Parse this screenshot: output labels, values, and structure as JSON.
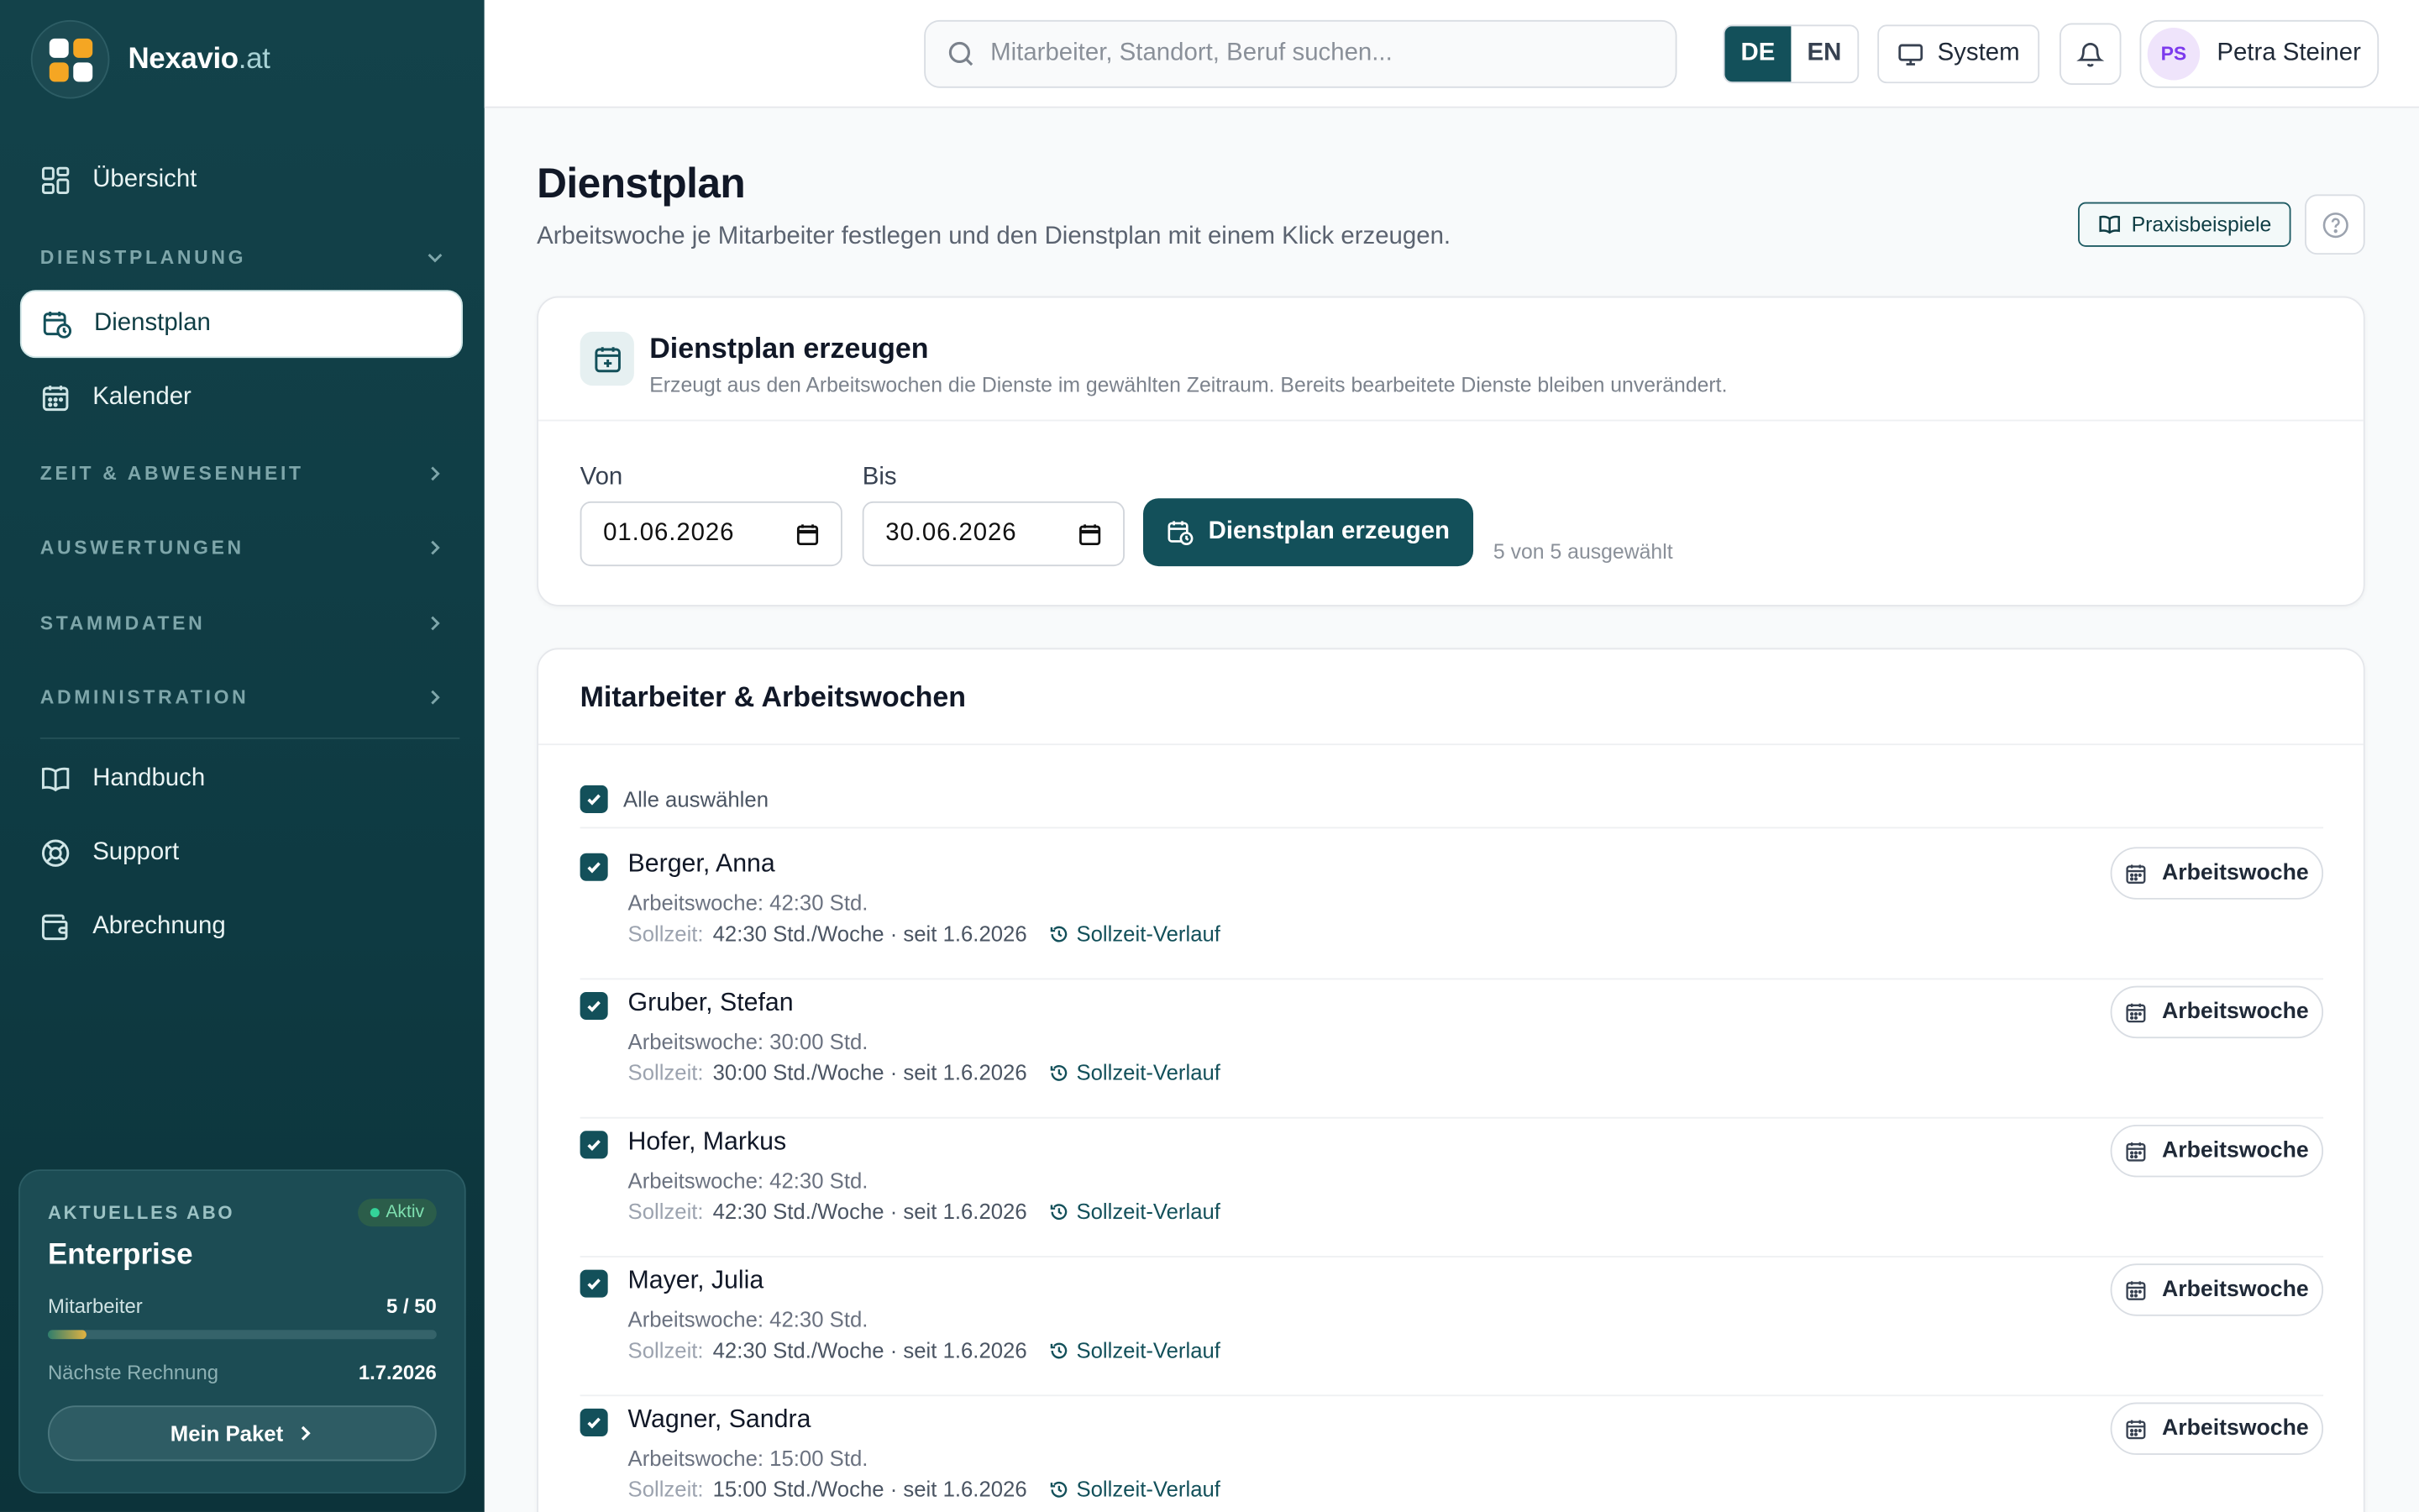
{
  "brand": {
    "name": "Nexavio",
    "tld": ".at"
  },
  "sidebar": {
    "overview": "Übersicht",
    "sections": {
      "dienstplanung": "DIENSTPLANUNG",
      "zeit": "ZEIT & ABWESENHEIT",
      "auswertungen": "AUSWERTUNGEN",
      "stammdaten": "STAMMDATEN",
      "administration": "ADMINISTRATION"
    },
    "items": {
      "dienstplan": "Dienstplan",
      "kalender": "Kalender",
      "handbuch": "Handbuch",
      "support": "Support",
      "abrechnung": "Abrechnung"
    },
    "plan": {
      "label": "AKTUELLES ABO",
      "status": "Aktiv",
      "name": "Enterprise",
      "employees_label": "Mitarbeiter",
      "employees_value": "5 / 50",
      "employees_fraction": 0.1,
      "next_invoice_label": "Nächste Rechnung",
      "next_invoice_value": "1.7.2026",
      "button": "Mein Paket"
    }
  },
  "topbar": {
    "search_placeholder": "Mitarbeiter, Standort, Beruf suchen...",
    "lang_de": "DE",
    "lang_en": "EN",
    "theme": "System",
    "user_initials": "PS",
    "user_name": "Petra Steiner"
  },
  "page": {
    "title": "Dienstplan",
    "subtitle": "Arbeitswoche je Mitarbeiter festlegen und den Dienstplan mit einem Klick erzeugen.",
    "examples_button": "Praxisbeispiele"
  },
  "generate": {
    "title": "Dienstplan erzeugen",
    "description": "Erzeugt aus den Arbeitswochen die Dienste im gewählten Zeitraum. Bereits bearbeitete Dienste bleiben unverändert.",
    "from_label": "Von",
    "from_value": "01.06.2026",
    "to_label": "Bis",
    "to_value": "30.06.2026",
    "button": "Dienstplan erzeugen",
    "selection": "5 von 5 ausgewählt"
  },
  "employees": {
    "title": "Mitarbeiter & Arbeitswochen",
    "select_all": "Alle auswählen",
    "soll_label": "Sollzeit:",
    "history_link": "Sollzeit-Verlauf",
    "week_button": "Arbeitswoche",
    "rows": [
      {
        "name": "Berger, Anna",
        "week": "Arbeitswoche: 42:30 Std.",
        "soll": "42:30 Std./Woche · seit 1.6.2026"
      },
      {
        "name": "Gruber, Stefan",
        "week": "Arbeitswoche: 30:00 Std.",
        "soll": "30:00 Std./Woche · seit 1.6.2026"
      },
      {
        "name": "Hofer, Markus",
        "week": "Arbeitswoche: 42:30 Std.",
        "soll": "42:30 Std./Woche · seit 1.6.2026"
      },
      {
        "name": "Mayer, Julia",
        "week": "Arbeitswoche: 42:30 Std.",
        "soll": "42:30 Std./Woche · seit 1.6.2026"
      },
      {
        "name": "Wagner, Sandra",
        "week": "Arbeitswoche: 15:00 Std.",
        "soll": "15:00 Std./Woche · seit 1.6.2026"
      }
    ]
  },
  "colors": {
    "accent": "#13505a",
    "sidebar": "#0f3d44"
  }
}
